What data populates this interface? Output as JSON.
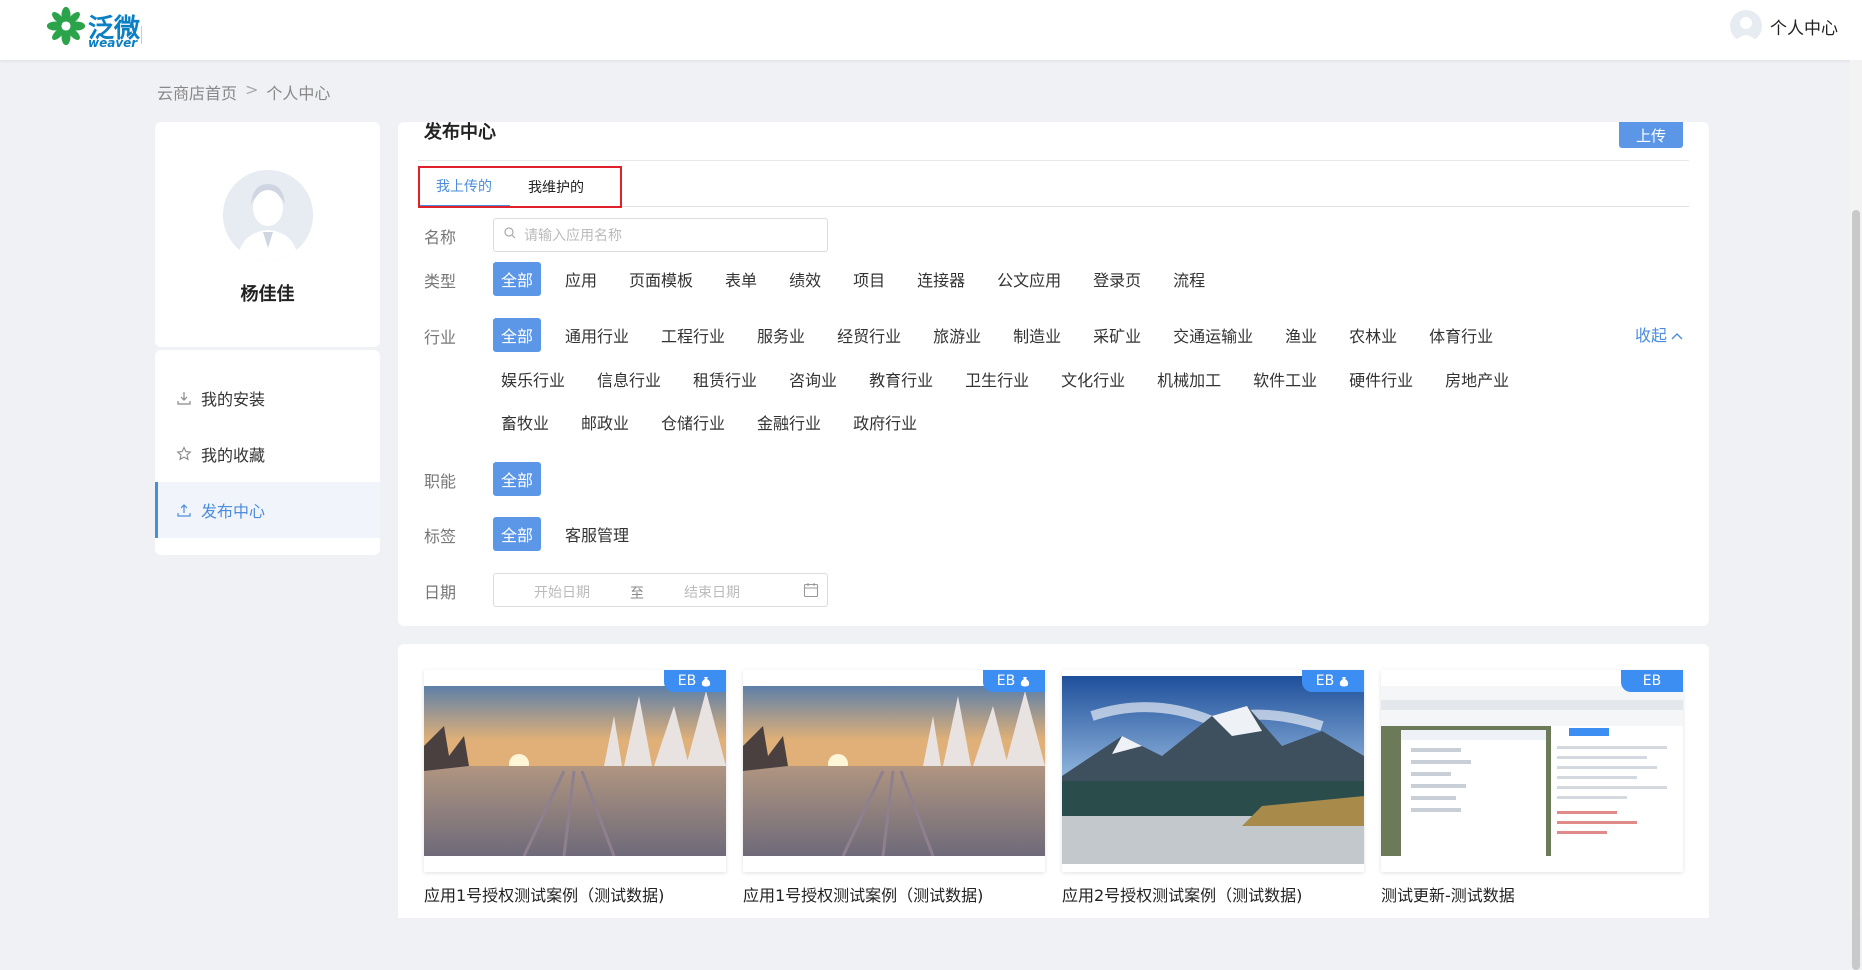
{
  "header": {
    "logo_text": "泛微",
    "logo_sub": "weaver",
    "user_label": "个人中心"
  },
  "breadcrumb": {
    "home": "云商店首页",
    "separator": ">",
    "current": "个人中心"
  },
  "profile": {
    "name": "杨佳佳"
  },
  "menu": {
    "items": [
      {
        "label": "我的安装",
        "icon": "download-icon"
      },
      {
        "label": "我的收藏",
        "icon": "star-icon"
      },
      {
        "label": "发布中心",
        "icon": "upload-icon"
      }
    ],
    "active_index": 2
  },
  "panel": {
    "title": "发布中心",
    "upload_label": "上传",
    "tabs": [
      "我上传的",
      "我维护的"
    ],
    "active_tab": 0
  },
  "filters": {
    "name_label": "名称",
    "search_placeholder": "请输入应用名称",
    "type_label": "类型",
    "types": [
      "全部",
      "应用",
      "页面模板",
      "表单",
      "绩效",
      "项目",
      "连接器",
      "公文应用",
      "登录页",
      "流程"
    ],
    "industry_label": "行业",
    "industries_row1": [
      "全部",
      "通用行业",
      "工程行业",
      "服务业",
      "经贸行业",
      "旅游业",
      "制造业",
      "采矿业",
      "交通运输业",
      "渔业",
      "农林业",
      "体育行业"
    ],
    "industries_row2": [
      "娱乐行业",
      "信息行业",
      "租赁行业",
      "咨询业",
      "教育行业",
      "卫生行业",
      "文化行业",
      "机械加工",
      "软件工业",
      "硬件行业",
      "房地产业"
    ],
    "industries_row3": [
      "畜牧业",
      "邮政业",
      "仓储行业",
      "金融行业",
      "政府行业"
    ],
    "collapse_label": "收起",
    "function_label": "职能",
    "functions": [
      "全部"
    ],
    "tag_label": "标签",
    "tags": [
      "全部",
      "客服管理"
    ],
    "date_label": "日期",
    "date_start_placeholder": "开始日期",
    "date_separator": "至",
    "date_end_placeholder": "结束日期"
  },
  "cards": [
    {
      "title": "应用1号授权测试案例（测试数据)",
      "badge": "EB",
      "image": "snow-road"
    },
    {
      "title": "应用1号授权测试案例（测试数据)",
      "badge": "EB",
      "image": "snow-road"
    },
    {
      "title": "应用2号授权测试案例（测试数据)",
      "badge": "EB",
      "image": "mountain-lake"
    },
    {
      "title": "测试更新-测试数据",
      "badge": "EB",
      "image": "screenshot"
    }
  ],
  "colors": {
    "accent": "#4a8ddc",
    "chip_active": "#5b97e6",
    "badge": "#3c8ef3",
    "highlight_border": "#e0202a",
    "page_bg": "#f0f1f4"
  }
}
